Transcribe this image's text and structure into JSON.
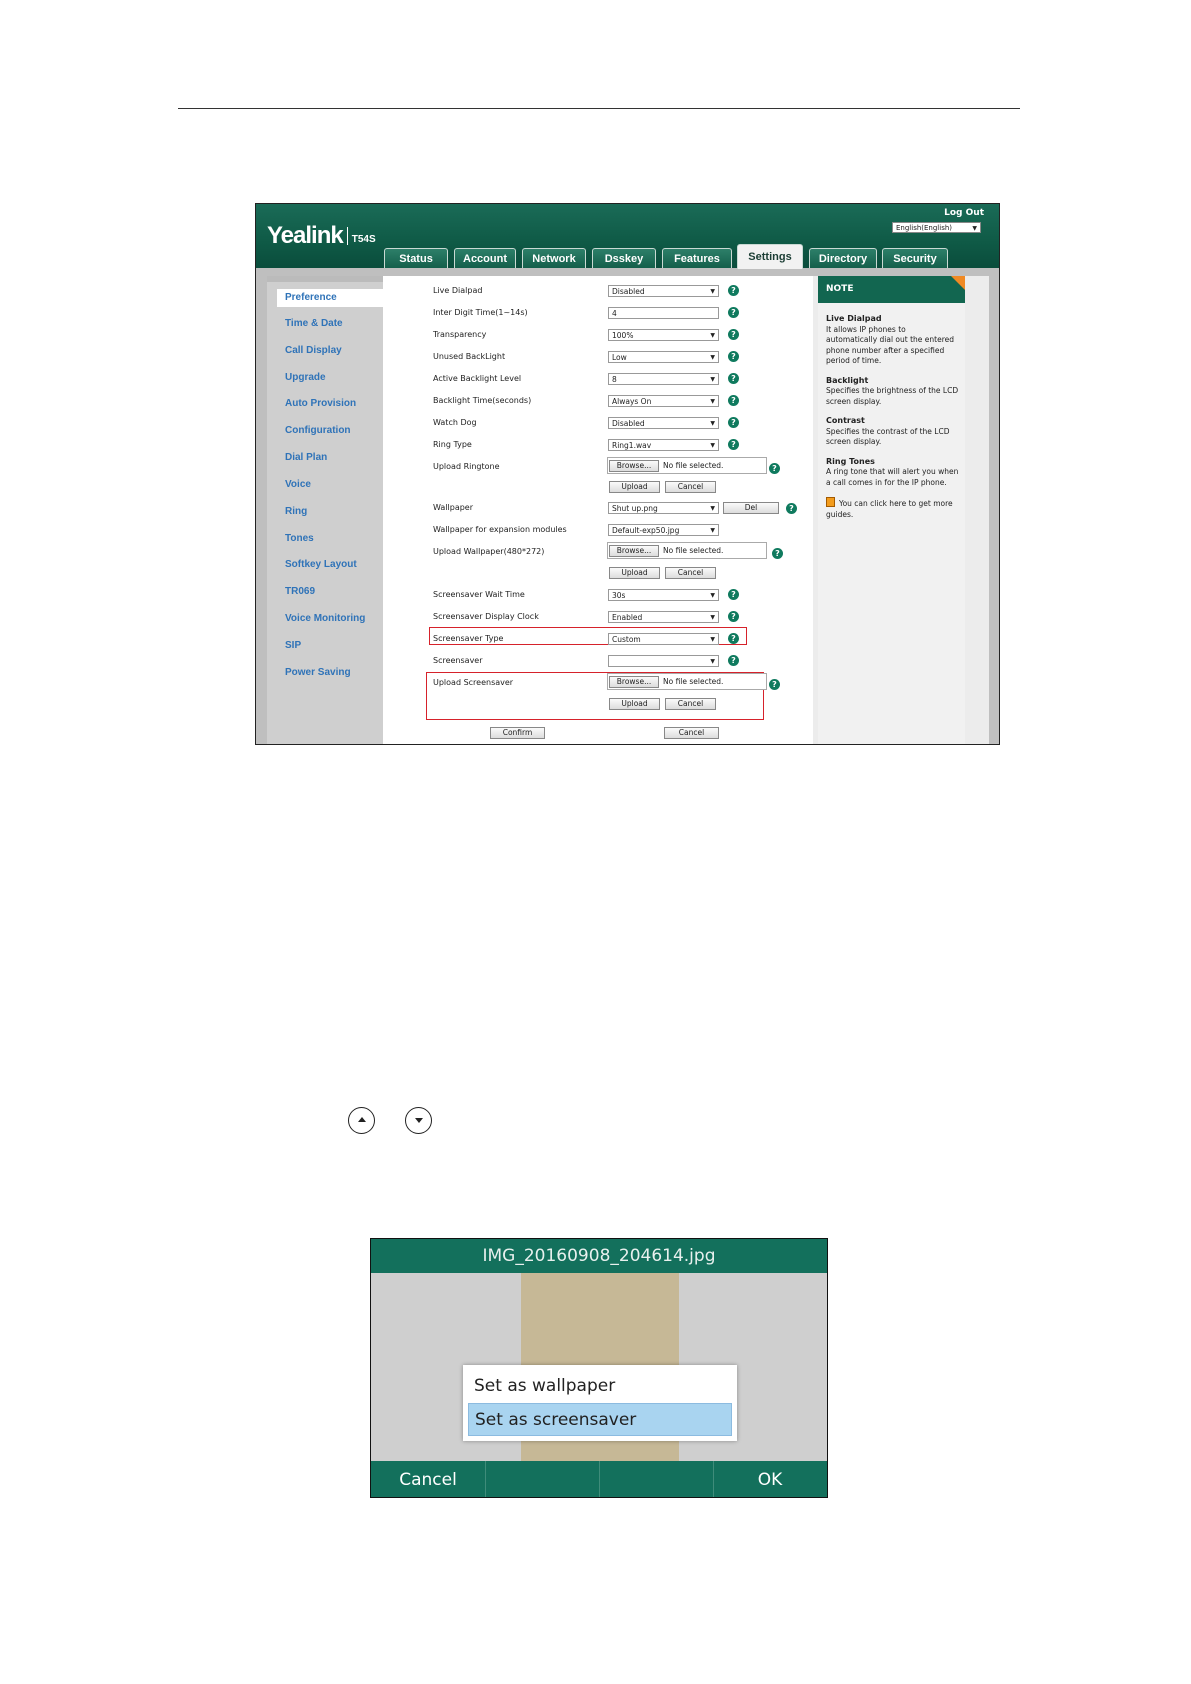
{
  "web": {
    "brand": "Yealink",
    "model": "T54S",
    "logout": "Log Out",
    "language": "English(English)",
    "tabs": [
      "Status",
      "Account",
      "Network",
      "Dsskey",
      "Features",
      "Settings",
      "Directory",
      "Security"
    ],
    "active_tab": "Settings",
    "sidebar": [
      "Preference",
      "Time & Date",
      "Call Display",
      "Upgrade",
      "Auto Provision",
      "Configuration",
      "Dial Plan",
      "Voice",
      "Ring",
      "Tones",
      "Softkey Layout",
      "TR069",
      "Voice Monitoring",
      "SIP",
      "Power Saving"
    ],
    "fields": {
      "live_dialpad": {
        "label": "Live Dialpad",
        "value": "Disabled"
      },
      "inter_digit": {
        "label": "Inter Digit Time(1~14s)",
        "value": "4"
      },
      "transparency": {
        "label": "Transparency",
        "value": "100%"
      },
      "unused_backlight": {
        "label": "Unused BackLight",
        "value": "Low"
      },
      "active_backlight": {
        "label": "Active Backlight Level",
        "value": "8"
      },
      "backlight_time": {
        "label": "Backlight Time(seconds)",
        "value": "Always On"
      },
      "watch_dog": {
        "label": "Watch Dog",
        "value": "Disabled"
      },
      "ring_type": {
        "label": "Ring Type",
        "value": "Ring1.wav"
      },
      "upload_ringtone": {
        "label": "Upload Ringtone"
      },
      "wallpaper": {
        "label": "Wallpaper",
        "value": "Shut up.png"
      },
      "wallpaper_exp": {
        "label": "Wallpaper for expansion modules",
        "value": "Default-exp50.jpg"
      },
      "upload_wallpaper": {
        "label": "Upload Wallpaper(480*272)"
      },
      "ss_wait": {
        "label": "Screensaver Wait Time",
        "value": "30s"
      },
      "ss_clock": {
        "label": "Screensaver Display Clock",
        "value": "Enabled"
      },
      "ss_type": {
        "label": "Screensaver Type",
        "value": "Custom"
      },
      "screensaver": {
        "label": "Screensaver",
        "value": ""
      },
      "upload_screensaver": {
        "label": "Upload Screensaver"
      }
    },
    "browse": "Browse...",
    "no_file": "No file selected.",
    "upload": "Upload",
    "cancel": "Cancel",
    "del": "Del",
    "confirm": "Confirm",
    "help": "?",
    "note": {
      "title": "NOTE",
      "sections": [
        {
          "title": "Live Dialpad",
          "text": "It allows IP phones to automatically dial out the entered phone number after a specified period of time."
        },
        {
          "title": "Backlight",
          "text": "Specifies the brightness of the LCD screen display."
        },
        {
          "title": "Contrast",
          "text": "Specifies the contrast of the LCD screen display."
        },
        {
          "title": "Ring Tones",
          "text": "A ring tone that will alert you when a call comes in for the IP phone."
        }
      ],
      "guide": "You can click here to get more guides."
    }
  },
  "phone": {
    "title": "IMG_20160908_204614.jpg",
    "menu": [
      "Set as wallpaper",
      "Set as screensaver"
    ],
    "selected_index": 1,
    "softkeys": [
      "Cancel",
      "",
      "",
      "OK"
    ]
  },
  "icons": [
    "arrow-up-key-icon",
    "arrow-down-key-icon"
  ],
  "colors": {
    "brand_green": "#13705c",
    "highlight": "#d6222b",
    "selection": "#a9d4f0"
  }
}
